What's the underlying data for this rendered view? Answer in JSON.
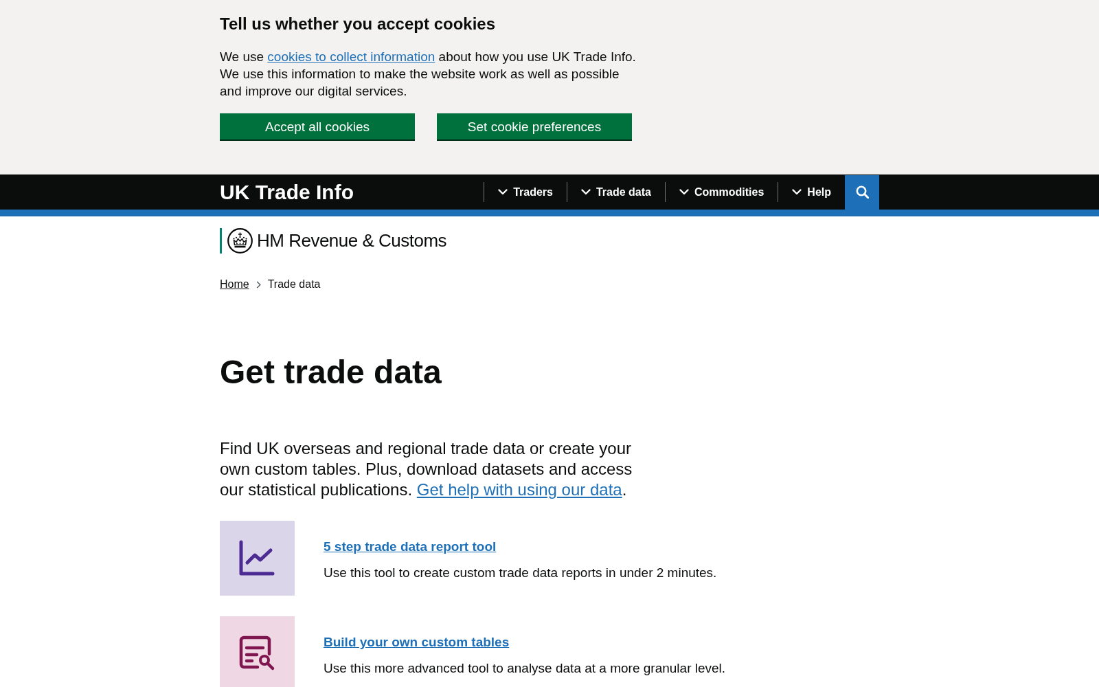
{
  "cookie_banner": {
    "heading": "Tell us whether you accept cookies",
    "message": {
      "before_link": "We use",
      "link": "cookies to collect information",
      "after_link": "about how you use UK Trade Info. We use this information to make the website work as well as possible and improve our digital services."
    },
    "buttons": [
      {
        "label": "Accept all cookies"
      },
      {
        "label": "Set cookie preferences"
      }
    ]
  },
  "header": {
    "site_name": "UK Trade Info",
    "nav": [
      {
        "label": "Traders",
        "expanded": false
      },
      {
        "label": "Trade data",
        "expanded": false
      },
      {
        "label": "Commodities",
        "expanded": false
      },
      {
        "label": "Help",
        "expanded": false
      }
    ]
  },
  "organisation": {
    "name": "HM Revenue & Customs"
  },
  "breadcrumbs": [
    {
      "label": "Home",
      "kind": "link"
    },
    {
      "label": "Trade data",
      "kind": "current"
    }
  ],
  "page": {
    "title": "Get trade data",
    "intro": {
      "text": "Find UK overseas and regional trade data or create your own custom tables. Plus, download datasets and access our statistical publications.",
      "link": "Get help with using our data",
      "after_link": "."
    }
  },
  "tools": [
    {
      "kind": "chart",
      "title": "5 step trade data report tool",
      "description": "Use this tool to create custom trade data reports in under 2 minutes."
    },
    {
      "kind": "document",
      "title": "Build your own custom tables",
      "description": "Use this more advanced tool to analyse data at a more granular level."
    }
  ]
}
